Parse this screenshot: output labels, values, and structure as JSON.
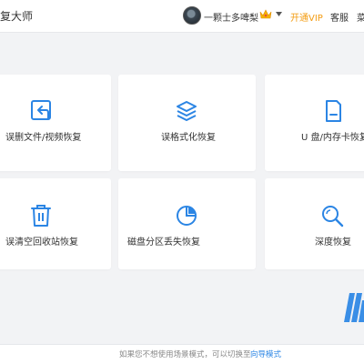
{
  "header": {
    "app_title": "复大师",
    "username": "一颗士多啤梨",
    "vip_label": "开通VIP",
    "service_label": "客服",
    "menu_cut": "菜",
    "crown_icon": "crown-icon",
    "avatar_icon": "user-avatar"
  },
  "cards": [
    {
      "label": "误删文件/视频恢复",
      "icon": "file-restore-icon"
    },
    {
      "label": "误格式化恢复",
      "icon": "layers-icon"
    },
    {
      "label": "U 盘/内存卡恢复",
      "icon": "sd-card-icon"
    },
    {
      "label": "误清空回收站恢复",
      "icon": "trash-icon"
    },
    {
      "label": "磁盘分区丢失恢复",
      "icon": "pie-chart-icon"
    },
    {
      "label": "深度恢复",
      "icon": "search-icon"
    }
  ],
  "footer": {
    "text": "如果您不想使用场景模式，可以切换至",
    "guide_link": "向导模式"
  },
  "colors": {
    "accent": "#2b85e4",
    "vip": "#f39c12",
    "background": "#f2f3f5"
  }
}
